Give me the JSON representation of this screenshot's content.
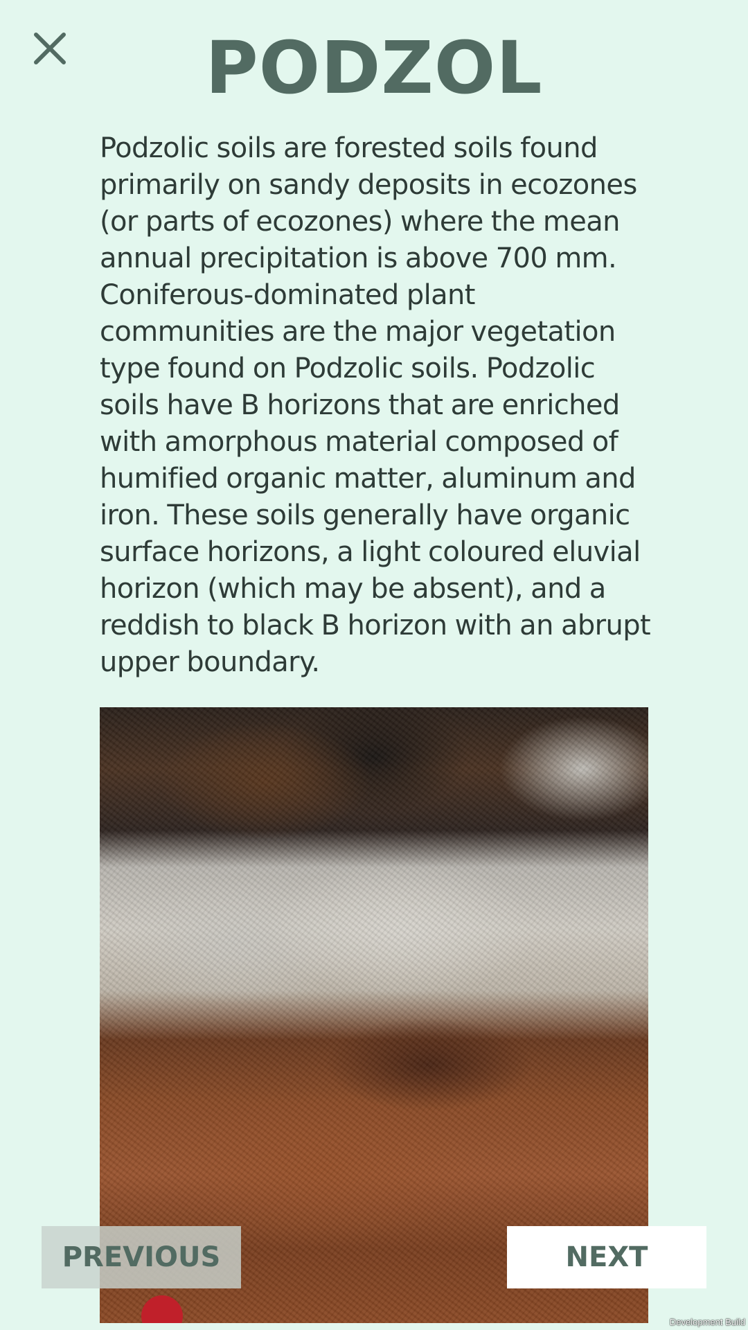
{
  "header": {
    "title": "PODZOL",
    "close_icon": "close-icon"
  },
  "main": {
    "description": "Podzolic soils are forested soils found primarily on sandy deposits in ecozones (or parts of ecozones) where the mean annual precipitation is above 700 mm. Coniferous-dominated plant communities are the major vegetation type found on Podzolic soils. Podzolic soils have B horizons that are enriched with amorphous material composed of humified organic matter, aluminum and iron. These soils generally have organic surface horizons, a light coloured eluvial horizon (which may be absent), and a reddish to black B horizon with an abrupt upper boundary."
  },
  "navigation": {
    "previous_label": "PREVIOUS",
    "next_label": "NEXT"
  },
  "footer": {
    "build_label": "Development Build"
  },
  "colors": {
    "background": "#e3f7ee",
    "title": "#526b62",
    "text": "#2e3b37",
    "next_button_bg": "#ffffff",
    "previous_button_bg": "#c8d2cd"
  }
}
